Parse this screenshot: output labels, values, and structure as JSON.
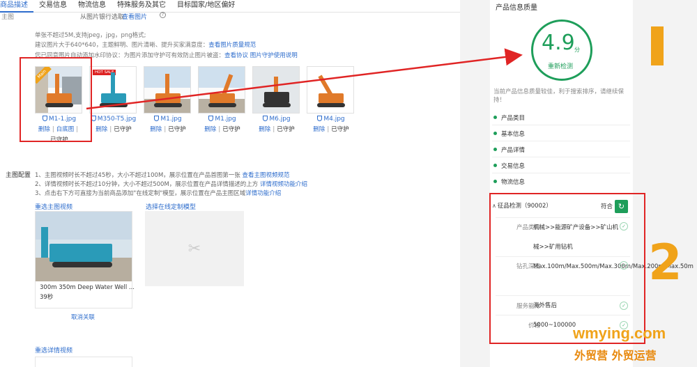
{
  "tabs": [
    {
      "label": "商品描述",
      "active": true
    },
    {
      "label": "交易信息"
    },
    {
      "label": "物流信息"
    },
    {
      "label": "特殊服务及其它"
    },
    {
      "label": "目标国家/地区偏好"
    }
  ],
  "top_row": {
    "label": "主图",
    "option": "从图片银行选取",
    "link": "查看图片",
    "help": "?"
  },
  "image_rules": {
    "line1": "单张不超过5M,支持jpeg，jpg，png格式;",
    "line2_text": "建议图片大于640*640，主题鲜明、图片清晰、提升买家满意度：",
    "line2_link": "查看图片质量规范",
    "line3_text": "您已同意图片自动添加水印协议：为图片添加守护可有效防止图片被盗：",
    "line3_link1": "查看协议",
    "line3_link2": "图片守护使用说明"
  },
  "thumbnails": [
    {
      "name": "M1-1.jpg",
      "action1": "删除",
      "action2": "白底图",
      "status": "已守护",
      "badge": "Main"
    },
    {
      "name": "M350-T5.jpg",
      "action1": "删除",
      "status": "已守护",
      "badge": "HOT SALE"
    },
    {
      "name": "M1.jpg",
      "action1": "删除",
      "status": "已守护"
    },
    {
      "name": "M1.jpg",
      "action1": "删除",
      "status": "已守护"
    },
    {
      "name": "M6.jpg",
      "action1": "删除",
      "status": "已守护"
    },
    {
      "name": "M4.jpg",
      "action1": "删除",
      "status": "已守护"
    }
  ],
  "video_section": {
    "label": "主图配置",
    "note1_text": "1、主图视频时长不超过45秒，大小不超过100M，展示位置在产品首图第一张",
    "note1_link": "查看主图视频规范",
    "note2_text": "2、详情视频时长不超过10分钟，大小不超过500M，展示位置在产品详情描述的上方",
    "note2_link": "详情视频功能介绍",
    "note3_text": "3、点击右下方可直接为当前商品添加\"在线定制\"模型，展示位置在产品主图区域",
    "note3_link": "详情功能介绍",
    "reselect_main_video": "重选主图视频",
    "select_model": "选择在线定制模型",
    "video_title": "300m 350m Deep Water Well ...",
    "video_duration": "39秒",
    "unlink": "取消关联",
    "reselect_detail_video": "重选详情视频"
  },
  "quality_panel": {
    "title": "产品信息质量",
    "score": "4.9",
    "score_unit": "分",
    "recheck": "重新检测",
    "tip": "当前产品信息质量较佳，利于搜索排序，请继续保持！",
    "categories": [
      "产品类目",
      "基本信息",
      "产品详情",
      "交易信息",
      "物流信息"
    ]
  },
  "attr_check": {
    "title": "征品检测（90002）",
    "status": "符合",
    "rows": [
      {
        "key": "产品类目",
        "value": "机械>>能源矿产设备>>矿山机械>>矿用钻机"
      },
      {
        "key": "钻孔深度",
        "value": "Max.100m/Max.500m/Max.300m/Max.200m/Max.50m"
      },
      {
        "key": "服务能力",
        "value": "海外售后"
      },
      {
        "key": "价格",
        "value": "5000~100000"
      }
    ]
  },
  "annotations": {
    "num1": "1",
    "num2": "2"
  },
  "watermark": {
    "line1": "wmying.com",
    "line2": "外贸营 外贸运营"
  },
  "colors": {
    "accent_blue": "#2d6ccc",
    "green": "#1e9e5a",
    "annotation_red": "#e02424",
    "annotation_orange": "#f0a31a"
  }
}
